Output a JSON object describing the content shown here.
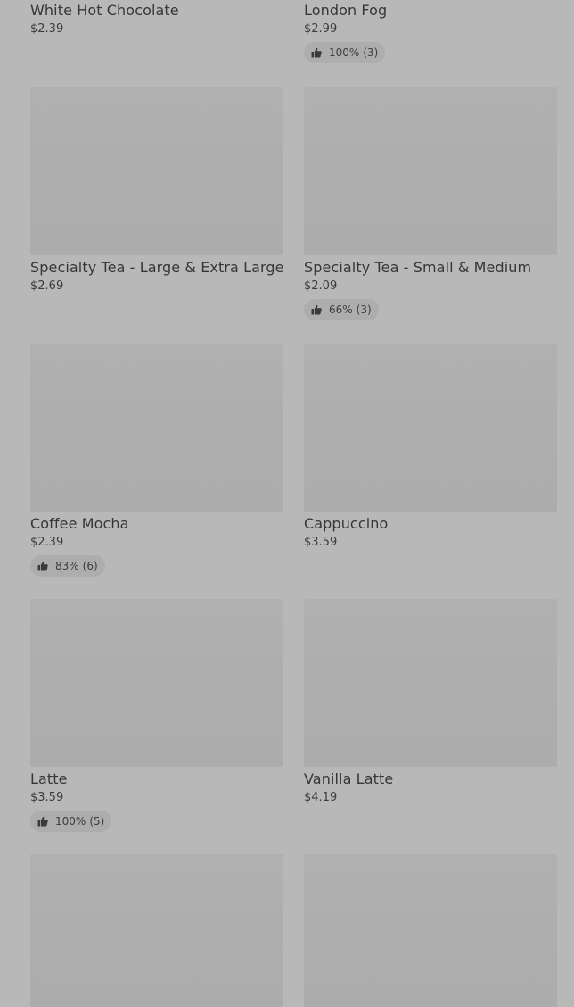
{
  "items": [
    {
      "name": "White Hot Chocolate",
      "price": "$2.39",
      "rating": null
    },
    {
      "name": "London Fog",
      "price": "$2.99",
      "rating": {
        "percent": "100%",
        "count": "(3)"
      }
    },
    {
      "name": "Specialty Tea - Large & Extra Large",
      "price": "$2.69",
      "rating": null
    },
    {
      "name": "Specialty Tea - Small & Medium",
      "price": "$2.09",
      "rating": {
        "percent": "66%",
        "count": "(3)"
      }
    },
    {
      "name": "Coffee Mocha",
      "price": "$2.39",
      "rating": {
        "percent": "83%",
        "count": "(6)"
      }
    },
    {
      "name": "Cappuccino",
      "price": "$3.59",
      "rating": null
    },
    {
      "name": "Latte",
      "price": "$3.59",
      "rating": {
        "percent": "100%",
        "count": "(5)"
      }
    },
    {
      "name": "Vanilla Latte",
      "price": "$4.19",
      "rating": null
    }
  ],
  "icons": {
    "rating": "thumbs-up-icon"
  }
}
